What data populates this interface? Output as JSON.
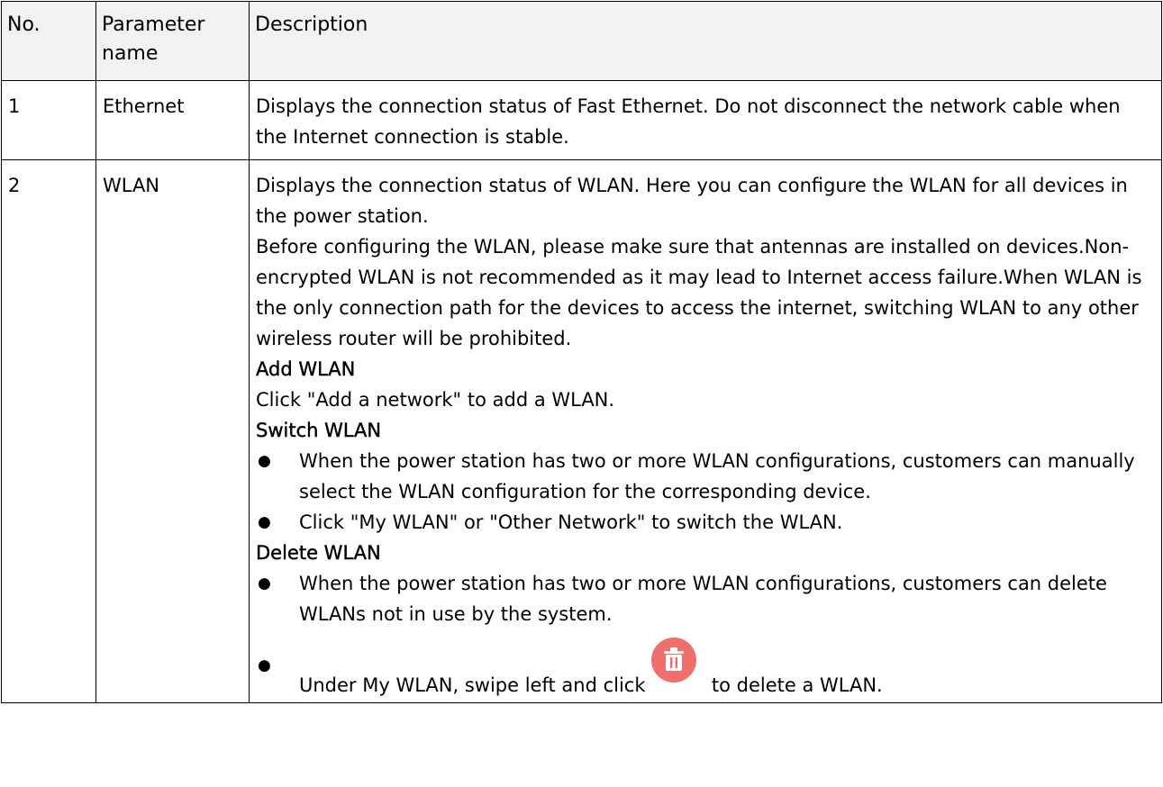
{
  "table": {
    "headers": [
      "No.",
      "Parameter name",
      "Description"
    ],
    "rows": [
      {
        "no": "1",
        "name": "Ethernet",
        "description": "Displays the connection status of Fast Ethernet. Do not disconnect the network cable when the Internet connection is stable."
      },
      {
        "no": "2",
        "name": "WLAN",
        "intro": "Displays the connection status of WLAN. Here you can configure the WLAN for all devices in the power station.",
        "notice": "Before configuring the WLAN, please make sure that antennas are installed on devices.Non-encrypted WLAN is not recommended as it may lead to Internet access failure.When WLAN is the only connection path for the devices to access the internet, switching WLAN to any other wireless router will be prohibited.",
        "add": {
          "heading": "Add WLAN",
          "text": "Click \"Add a network\" to add a WLAN."
        },
        "switch": {
          "heading": "Switch WLAN",
          "bullets": [
            "When the power station has two or more WLAN configurations, customers can manually select the WLAN configuration for the corresponding device.",
            "Click \"My WLAN\" or \"Other Network\" to switch the WLAN."
          ]
        },
        "delete": {
          "heading": "Delete WLAN",
          "bullet_1": "When the power station has two or more WLAN configurations, customers can delete WLANs not in use by the system.",
          "bullet_2_before_icon": "Under My WLAN, swipe left and click",
          "bullet_2_after_icon": "to delete a WLAN.",
          "icon": "trash-icon",
          "icon_color": "#ef6f6c"
        }
      }
    ]
  },
  "bullet_glyph": "●"
}
